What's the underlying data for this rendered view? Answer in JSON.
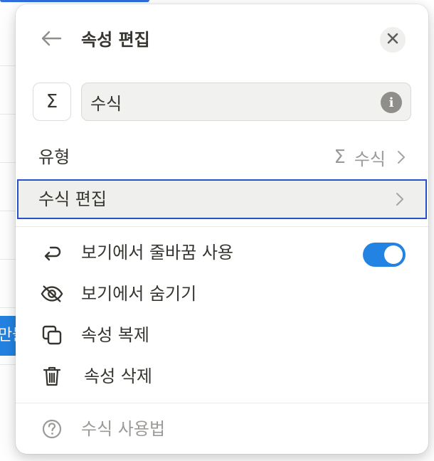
{
  "background": {
    "button_text": "만들"
  },
  "panel": {
    "title": "속성 편집",
    "name_input": {
      "value": "수식",
      "type_icon": "sigma-icon"
    },
    "type_row": {
      "label": "유형",
      "value": "수식",
      "icon": "sigma-icon"
    },
    "edit_formula": {
      "label": "수식 편집"
    },
    "menu": {
      "wrap": {
        "label": "보기에서 줄바꿈 사용",
        "icon": "wrap-arrow-icon",
        "toggle_on": true
      },
      "hide": {
        "label": "보기에서 숨기기",
        "icon": "eye-off-icon"
      },
      "duplicate": {
        "label": "속성 복제",
        "icon": "duplicate-icon"
      },
      "delete": {
        "label": "속성 삭제",
        "icon": "trash-icon"
      }
    },
    "help": {
      "label": "수식 사용법",
      "icon": "question-circle-icon"
    }
  },
  "colors": {
    "accent": "#2383e2",
    "focus_border": "#2453c7",
    "text": "#37352f",
    "muted": "#9b9a97"
  }
}
